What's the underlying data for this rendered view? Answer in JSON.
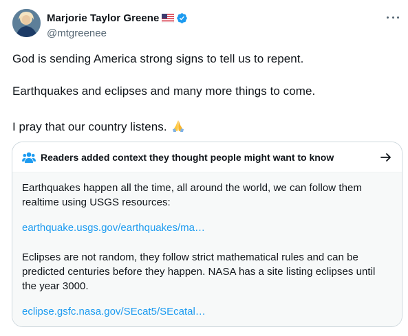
{
  "author": {
    "name": "Marjorie Taylor Greene",
    "handle": "@mtgreenee",
    "flag_icon": "us-flag-icon",
    "verified_icon": "verified-badge-icon",
    "verified_color": "#1d9bf0"
  },
  "menu": {
    "icon": "more-icon"
  },
  "tweet": {
    "line1": "God is sending America strong signs to tell us to repent.",
    "line2": "Earthquakes and eclipses and many more things to come.",
    "line3": "I pray that our country listens.",
    "emoji_icon": "folded-hands-icon"
  },
  "note": {
    "title": "Readers added context they thought people might want to know",
    "header_icon": "people-icon",
    "arrow_icon": "arrow-right-icon",
    "p1_line1": "Earthquakes happen all the time, all around the world, we can follow them",
    "p1_line2": "realtime using USGS resources:",
    "link1": "earthquake.usgs.gov/earthquakes/ma…",
    "p2_line1": "Eclipses are not random, they follow strict mathematical rules and can be",
    "p2_line2": "predicted centuries before they happen. NASA has a site listing eclipses until",
    "p2_line3": "the year 3000.",
    "link2": "eclipse.gsfc.nasa.gov/SEcat5/SEcatal…",
    "link_color": "#1d9bf0"
  }
}
